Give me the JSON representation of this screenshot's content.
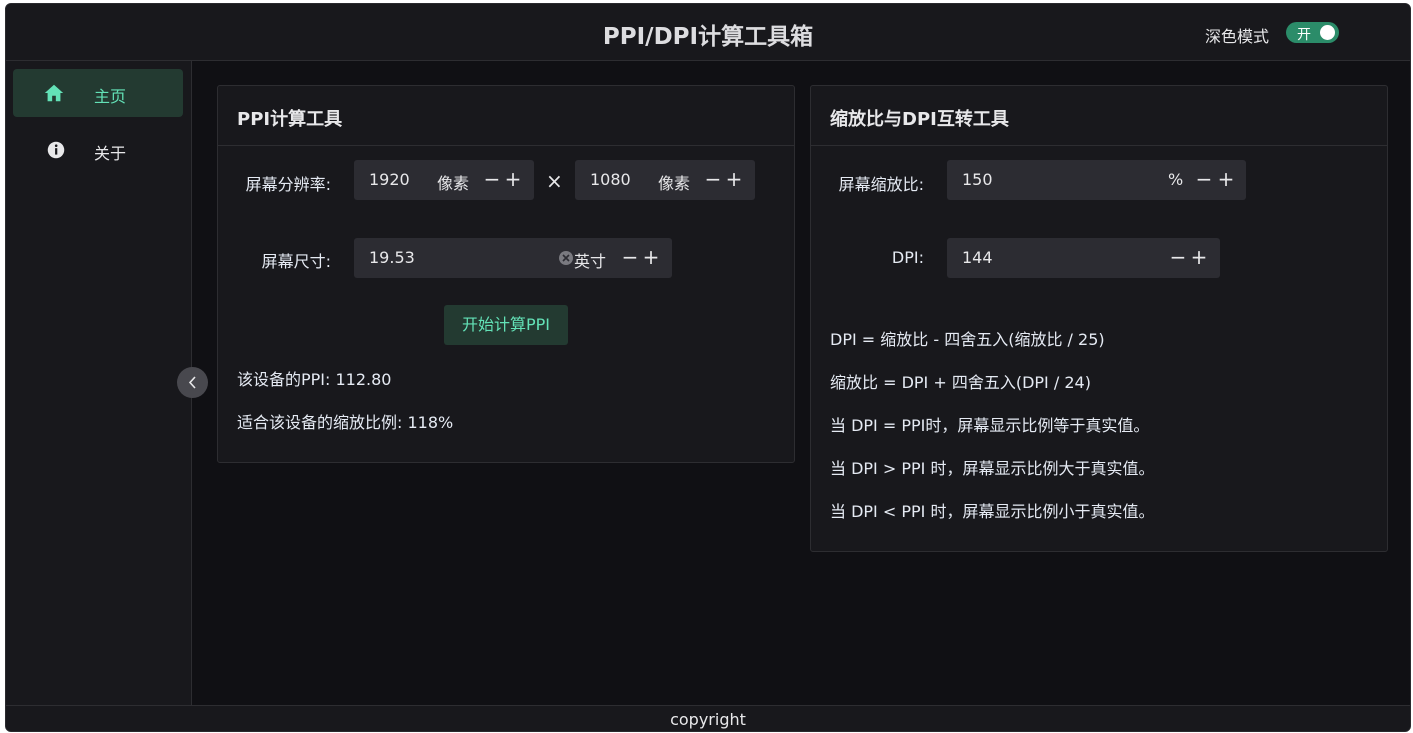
{
  "header": {
    "title": "PPI/DPI计算工具箱",
    "theme_label": "深色模式",
    "theme_toggle_text": "开",
    "theme_toggle_on": true
  },
  "sidebar": {
    "items": [
      {
        "label": "主页",
        "icon": "home-icon",
        "active": true
      },
      {
        "label": "关于",
        "icon": "info-icon",
        "active": false
      }
    ],
    "collapse_icon": "chevron-left-icon"
  },
  "ppi_card": {
    "title": "PPI计算工具",
    "resolution_label": "屏幕分辨率:",
    "width_value": "1920",
    "width_unit": "像素",
    "times_sign": "×",
    "height_value": "1080",
    "height_unit": "像素",
    "size_label": "屏幕尺寸:",
    "size_value": "19.53",
    "size_unit": "英寸",
    "calc_button": "开始计算PPI",
    "ppi_result": "该设备的PPI: 112.80",
    "scale_result": "适合该设备的缩放比例: 118%"
  },
  "dpi_card": {
    "title": "缩放比与DPI互转工具",
    "scale_label": "屏幕缩放比:",
    "scale_value": "150",
    "scale_unit": "%",
    "dpi_label": "DPI:",
    "dpi_value": "144",
    "info": [
      "DPI = 缩放比 - 四舍五入(缩放比 / 25)",
      "缩放比 = DPI + 四舍五入(DPI / 24)",
      "当 DPI = PPI时，屏幕显示比例等于真实值。",
      "当 DPI > PPI 时，屏幕显示比例大于真实值。",
      "当 DPI < PPI 时，屏幕显示比例小于真实值。"
    ]
  },
  "footer": {
    "copyright": "copyright"
  },
  "colors": {
    "accent": "#63e2b7",
    "toggle_on": "#2b8c69",
    "background": "#101014",
    "panel": "#18181c",
    "input": "#2c2c32"
  }
}
